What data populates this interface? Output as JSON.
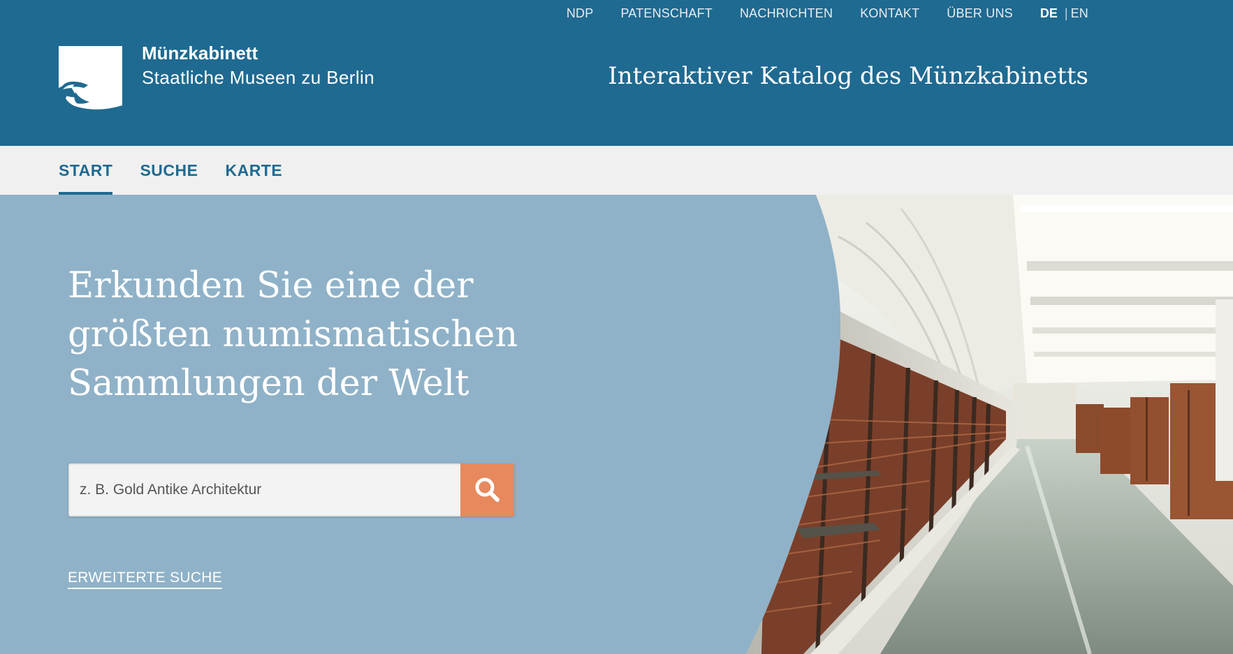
{
  "colors": {
    "header_blue": "#1f6a91",
    "nav_bg": "#f0f0f0",
    "hero_blue": "#8fb2c8",
    "search_button": "#e7895d"
  },
  "header": {
    "top_nav": [
      "NDP",
      "PATENSCHAFT",
      "NACHRICHTEN",
      "KONTAKT",
      "ÜBER UNS"
    ],
    "lang": {
      "active": "DE",
      "separator": "|",
      "other": "EN"
    },
    "logo_icon": "eagle-logo-icon",
    "brand_name": "Münzkabinett",
    "brand_sub": "Staatliche Museen zu Berlin",
    "catalog_title": "Interaktiver Katalog des Münzkabinetts"
  },
  "main_nav": {
    "items": [
      "START",
      "SUCHE",
      "KARTE"
    ],
    "active": "START"
  },
  "hero": {
    "headline_lines": [
      "Erkunden Sie eine der",
      "größten numismatischen",
      "Sammlungen der Welt"
    ],
    "search_placeholder": "z. B. Gold Antike Architektur",
    "search_icon": "search-icon",
    "advanced_search": "ERWEITERTE SUCHE",
    "photo_subject": "museum-corridor-photo"
  }
}
